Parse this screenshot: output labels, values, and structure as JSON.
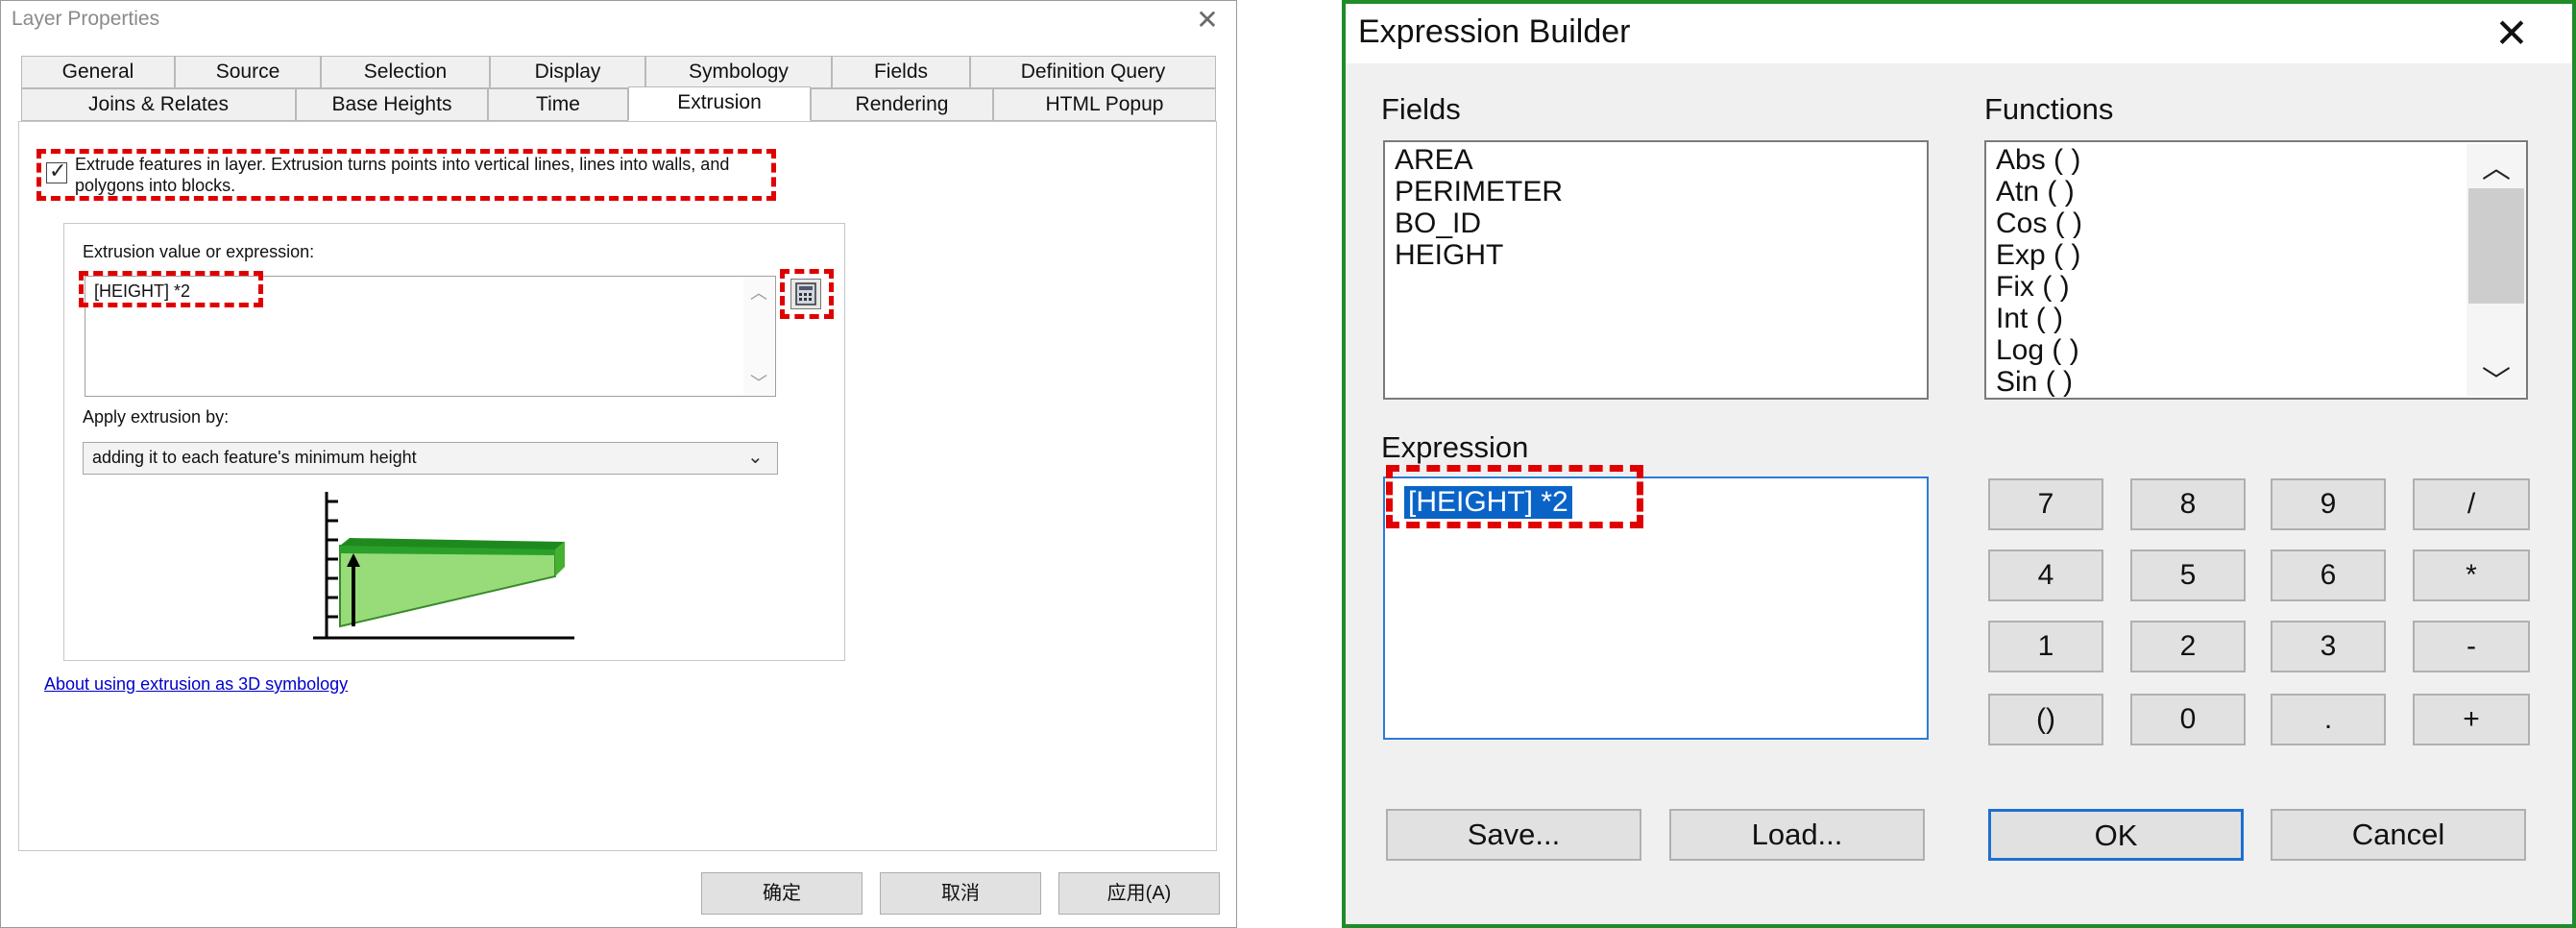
{
  "layer_properties": {
    "title": "Layer Properties",
    "tabs_row1": [
      "General",
      "Source",
      "Selection",
      "Display",
      "Symbology",
      "Fields",
      "Definition Query"
    ],
    "tabs_row2": [
      "Joins & Relates",
      "Base Heights",
      "Time",
      "Extrusion",
      "Rendering",
      "HTML Popup"
    ],
    "active_tab": "Extrusion",
    "extrude_checkbox_checked": true,
    "extrude_text": "Extrude features in layer.  Extrusion turns points into vertical lines, lines into walls, and polygons into blocks.",
    "extrusion_label": "Extrusion value or expression:",
    "extrusion_value": "[HEIGHT] *2",
    "apply_label": "Apply extrusion by:",
    "apply_value": "adding it to each feature's minimum height",
    "about_link": "About using extrusion as 3D symbology",
    "buttons": {
      "ok": "确定",
      "cancel": "取消",
      "apply": "应用(A)"
    }
  },
  "expression_builder": {
    "title": "Expression Builder",
    "fields_label": "Fields",
    "fields": [
      "AREA",
      "PERIMETER",
      "BO_ID",
      "HEIGHT"
    ],
    "functions_label": "Functions",
    "functions": [
      "Abs ( )",
      "Atn ( )",
      "Cos ( )",
      "Exp ( )",
      "Fix ( )",
      "Int ( )",
      "Log ( )",
      "Sin ( )"
    ],
    "expression_label": "Expression",
    "expression_value": "[HEIGHT] *2",
    "keypad": [
      "7",
      "8",
      "9",
      "/",
      "4",
      "5",
      "6",
      "*",
      "1",
      "2",
      "3",
      "-",
      "()",
      "0",
      ".",
      "+"
    ],
    "buttons": {
      "save": "Save...",
      "load": "Load...",
      "ok": "OK",
      "cancel": "Cancel"
    }
  },
  "colors": {
    "highlight_red": "#e00000",
    "eb_border_green": "#1f8c2a",
    "selection_blue": "#0a64c8"
  }
}
